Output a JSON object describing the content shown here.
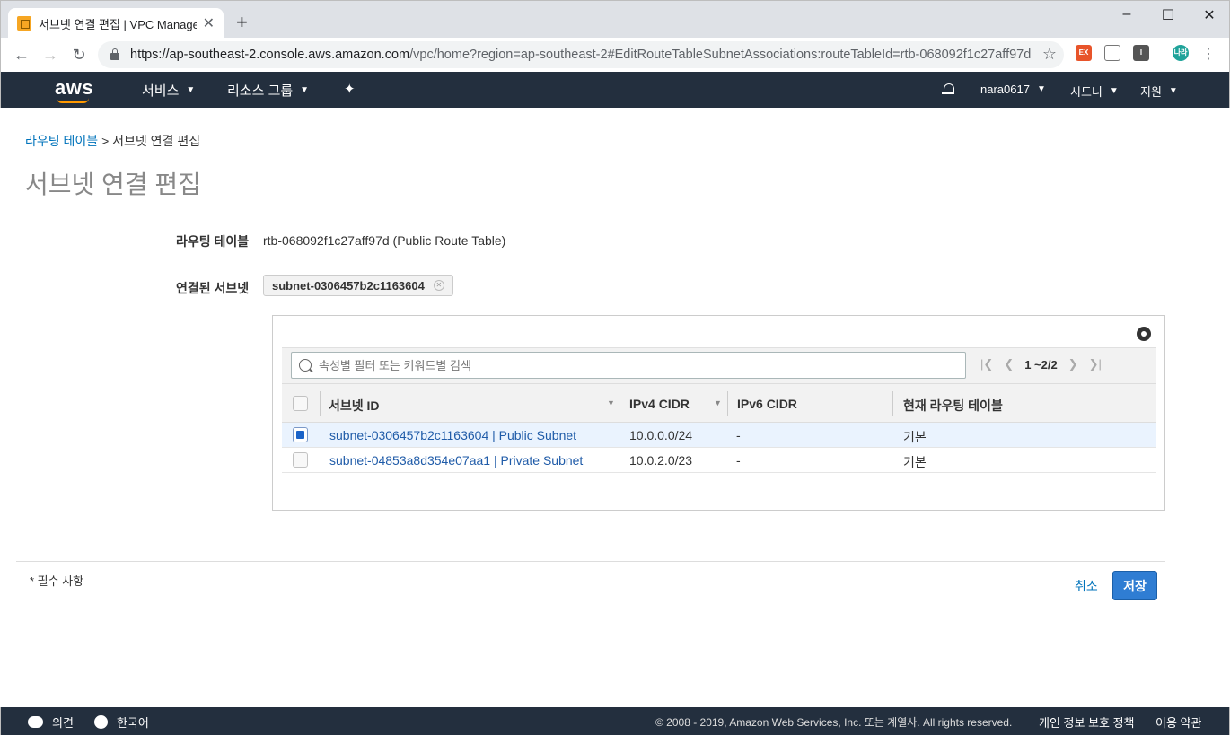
{
  "browser": {
    "tab_title": "서브넷 연결 편집 | VPC Manage",
    "url_host": "https://ap-southeast-2.console.aws.amazon.com",
    "url_path": "/vpc/home?region=ap-southeast-2#EditRouteTableSubnetAssociations:routeTableId=rtb-068092f1c27aff97d",
    "extensions": [
      "EX",
      "나라"
    ]
  },
  "aws_nav": {
    "logo": "aws",
    "services": "서비스",
    "resource_groups": "리소스 그룹",
    "account": "nara0617",
    "region": "시드니",
    "support": "지원"
  },
  "breadcrumb": {
    "parent": "라우팅 테이블",
    "separator": ">",
    "current": "서브넷 연결 편집"
  },
  "page": {
    "title": "서브넷 연결 편집",
    "route_table_label": "라우팅 테이블",
    "route_table_value": "rtb-068092f1c27aff97d (Public Route Table)",
    "associated_label": "연결된 서브넷",
    "associated_chip": "subnet-0306457b2c1163604"
  },
  "table": {
    "search_placeholder": "속성별 필터 또는 키워드별 검색",
    "pager_count": "1 ~2/2",
    "headers": [
      "서브넷 ID",
      "IPv4 CIDR",
      "IPv6 CIDR",
      "현재 라우팅 테이블"
    ],
    "rows": [
      {
        "subnet": "subnet-0306457b2c1163604 | Public Subnet",
        "ipv4": "10.0.0.0/24",
        "ipv6": "-",
        "route_table": "기본",
        "checked": true
      },
      {
        "subnet": "subnet-04853a8d354e07aa1 | Private Subnet",
        "ipv4": "10.0.2.0/23",
        "ipv6": "-",
        "route_table": "기본",
        "checked": false
      }
    ]
  },
  "footer": {
    "required_note": "* 필수 사항",
    "cancel_label": "취소",
    "save_label": "저장"
  },
  "bottom_bar": {
    "feedback": "의견",
    "language": "한국어",
    "copyright": "© 2008 - 2019, Amazon Web Services, Inc. 또는 계열사. All rights reserved.",
    "privacy": "개인 정보 보호 정책",
    "terms": "이용 약관"
  },
  "colors": {
    "aws_nav_bg": "#232f3e",
    "link": "#0073bb",
    "primary_button": "#2f7dd3",
    "selected_row": "#eaf3fe"
  }
}
